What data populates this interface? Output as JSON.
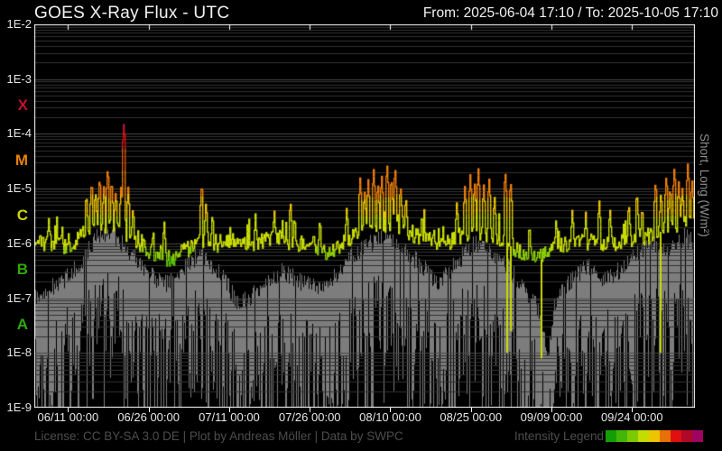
{
  "header": {
    "title": "GOES X-Ray Flux - UTC",
    "date_range": "From: 2025-06-04 17:10  /  To: 2025-10-05 17:10"
  },
  "axes": {
    "right_label": "Short, Long (W/m²)",
    "y_ticks": [
      {
        "label": "1E-2",
        "exp": -2
      },
      {
        "label": "1E-3",
        "exp": -3
      },
      {
        "label": "1E-4",
        "exp": -4
      },
      {
        "label": "1E-5",
        "exp": -5
      },
      {
        "label": "1E-6",
        "exp": -6
      },
      {
        "label": "1E-7",
        "exp": -7
      },
      {
        "label": "1E-8",
        "exp": -8
      },
      {
        "label": "1E-9",
        "exp": -9
      }
    ],
    "class_letters": [
      {
        "label": "X",
        "exp_mid": -3.5,
        "color": "#c41030"
      },
      {
        "label": "M",
        "exp_mid": -4.5,
        "color": "#e8820a"
      },
      {
        "label": "C",
        "exp_mid": -5.5,
        "color": "#cdd60a"
      },
      {
        "label": "B",
        "exp_mid": -6.5,
        "color": "#2fa90c"
      },
      {
        "label": "A",
        "exp_mid": -7.5,
        "color": "#2fa90c"
      }
    ],
    "x_ticks": [
      {
        "day": 6.285,
        "label": "06/11 00:00"
      },
      {
        "day": 21.285,
        "label": "06/26 00:00"
      },
      {
        "day": 36.285,
        "label": "07/11 00:00"
      },
      {
        "day": 51.285,
        "label": "07/26 00:00"
      },
      {
        "day": 66.285,
        "label": "08/10 00:00"
      },
      {
        "day": 81.285,
        "label": "08/25 00:00"
      },
      {
        "day": 96.285,
        "label": "09/09 00:00"
      },
      {
        "day": 111.285,
        "label": "09/24 00:00"
      }
    ]
  },
  "footer": {
    "license": "License: CC BY-SA 3.0 DE | Plot by Andreas Möller | Data by SWPC",
    "intensity_legend_label": "Intensity Legend"
  },
  "chart_data": {
    "type": "line",
    "title": "GOES X-Ray Flux - UTC",
    "x_start": "2025-06-04 17:10",
    "x_end": "2025-10-05 17:10",
    "days_total": 123,
    "ylog_range": [
      -9,
      -2
    ],
    "grid": "log-minor-gray",
    "legend_position": "bottom-right",
    "legend_colors": [
      "#149e06",
      "#45b508",
      "#7cc904",
      "#c4dc02",
      "#ecc400",
      "#e87008",
      "#e01010",
      "#b00828",
      "#a00460"
    ],
    "dropout_color": "#c9d900",
    "color_scale": [
      {
        "max": -6.55,
        "color": "#2aa30a"
      },
      {
        "max": -6.3,
        "color": "#55b907"
      },
      {
        "max": -6.1,
        "color": "#8ccc04"
      },
      {
        "max": -5.5,
        "color": "#c9dc02"
      },
      {
        "max": -5.15,
        "color": "#ecc400"
      },
      {
        "max": -4.6,
        "color": "#ee7e08"
      },
      {
        "max": -4.25,
        "color": "#e2560a"
      },
      {
        "max": -3.95,
        "color": "#dd1112"
      },
      {
        "max": 99,
        "color": "#b5123c"
      }
    ],
    "series": [
      {
        "name": "Long",
        "style": "intensity-colored",
        "anchors": [
          [
            0,
            -6.0
          ],
          [
            2,
            -6.05
          ],
          [
            4,
            -5.95
          ],
          [
            6,
            -6.1
          ],
          [
            8,
            -5.9
          ],
          [
            10,
            -5.78
          ],
          [
            13,
            -5.68
          ],
          [
            16,
            -5.75
          ],
          [
            19,
            -6.0
          ],
          [
            22,
            -6.2
          ],
          [
            25,
            -6.3
          ],
          [
            28,
            -6.15
          ],
          [
            31,
            -5.92
          ],
          [
            34,
            -6.02
          ],
          [
            37,
            -5.98
          ],
          [
            40,
            -6.02
          ],
          [
            44,
            -5.92
          ],
          [
            48,
            -6.0
          ],
          [
            52,
            -6.05
          ],
          [
            55,
            -6.18
          ],
          [
            58,
            -5.95
          ],
          [
            61,
            -5.78
          ],
          [
            64,
            -5.72
          ],
          [
            67,
            -5.68
          ],
          [
            70,
            -5.82
          ],
          [
            73,
            -5.95
          ],
          [
            76,
            -6.05
          ],
          [
            79,
            -5.92
          ],
          [
            82,
            -5.78
          ],
          [
            85,
            -5.85
          ],
          [
            88,
            -6.0
          ],
          [
            91,
            -6.25
          ],
          [
            94,
            -6.3
          ],
          [
            97,
            -6.1
          ],
          [
            100,
            -6.02
          ],
          [
            103,
            -5.98
          ],
          [
            106,
            -6.05
          ],
          [
            109,
            -6.0
          ],
          [
            112,
            -5.92
          ],
          [
            115,
            -5.85
          ],
          [
            118,
            -5.72
          ],
          [
            121,
            -5.62
          ],
          [
            123,
            -5.68
          ]
        ]
      },
      {
        "name": "Short",
        "style": "gray",
        "color": "#7d7d7d",
        "anchors": [
          [
            0,
            -7.2
          ],
          [
            3,
            -7.0
          ],
          [
            6,
            -6.8
          ],
          [
            9,
            -6.45
          ],
          [
            12,
            -6.0
          ],
          [
            14,
            -5.95
          ],
          [
            17,
            -6.25
          ],
          [
            20,
            -6.6
          ],
          [
            24,
            -6.95
          ],
          [
            28,
            -6.6
          ],
          [
            31,
            -6.35
          ],
          [
            35,
            -6.8
          ],
          [
            38,
            -7.3
          ],
          [
            42,
            -7.0
          ],
          [
            46,
            -6.7
          ],
          [
            50,
            -6.9
          ],
          [
            54,
            -7.0
          ],
          [
            58,
            -6.5
          ],
          [
            62,
            -6.2
          ],
          [
            65,
            -6.05
          ],
          [
            68,
            -6.25
          ],
          [
            72,
            -6.55
          ],
          [
            75,
            -6.9
          ],
          [
            78,
            -6.6
          ],
          [
            82,
            -6.15
          ],
          [
            85,
            -6.35
          ],
          [
            88,
            -6.55
          ],
          [
            91,
            -7.0
          ],
          [
            94,
            -7.4
          ],
          [
            95.5,
            -8.3
          ],
          [
            97,
            -7.2
          ],
          [
            100,
            -6.85
          ],
          [
            103,
            -6.55
          ],
          [
            106,
            -6.85
          ],
          [
            109,
            -6.65
          ],
          [
            112,
            -6.35
          ],
          [
            115,
            -6.15
          ],
          [
            118,
            -6.25
          ],
          [
            121,
            -6.05
          ],
          [
            123,
            -6.2
          ]
        ]
      }
    ],
    "flares": [
      [
        2.5,
        -5.5
      ],
      [
        5,
        -5.62
      ],
      [
        9.5,
        -5.05
      ],
      [
        10.5,
        -4.82
      ],
      [
        11.2,
        -5.0
      ],
      [
        12,
        -4.75
      ],
      [
        12.8,
        -4.9
      ],
      [
        13.5,
        -4.58
      ],
      [
        14.2,
        -4.8
      ],
      [
        15,
        -5.0
      ],
      [
        16,
        -4.9
      ],
      [
        16.5,
        -3.76
      ],
      [
        17.3,
        -4.95
      ],
      [
        18.2,
        -5.3
      ],
      [
        24,
        -5.55
      ],
      [
        31,
        -4.85
      ],
      [
        31.8,
        -5.2
      ],
      [
        33,
        -5.4
      ],
      [
        41,
        -5.45
      ],
      [
        44.5,
        -5.35
      ],
      [
        47.5,
        -5.18
      ],
      [
        48.3,
        -5.45
      ],
      [
        53,
        -5.5
      ],
      [
        58,
        -5.3
      ],
      [
        60.5,
        -4.78
      ],
      [
        61.3,
        -5.0
      ],
      [
        62,
        -4.82
      ],
      [
        63,
        -4.62
      ],
      [
        63.8,
        -4.85
      ],
      [
        64.5,
        -4.72
      ],
      [
        65.5,
        -4.52
      ],
      [
        66.3,
        -4.75
      ],
      [
        67,
        -4.58
      ],
      [
        68,
        -4.9
      ],
      [
        69,
        -5.1
      ],
      [
        72,
        -5.4
      ],
      [
        78.5,
        -5.2
      ],
      [
        80,
        -4.92
      ],
      [
        81,
        -4.72
      ],
      [
        81.8,
        -4.85
      ],
      [
        82.5,
        -4.62
      ],
      [
        83.5,
        -4.9
      ],
      [
        84.5,
        -4.78
      ],
      [
        85.5,
        -5.1
      ],
      [
        87.5,
        -4.65
      ],
      [
        88.5,
        -4.82
      ],
      [
        92,
        -5.6
      ],
      [
        97,
        -5.5
      ],
      [
        100,
        -5.35
      ],
      [
        102.5,
        -5.42
      ],
      [
        105,
        -5.18
      ],
      [
        107,
        -5.32
      ],
      [
        110.5,
        -5.22
      ],
      [
        112,
        -5.02
      ],
      [
        113,
        -5.28
      ],
      [
        115.5,
        -4.82
      ],
      [
        116.5,
        -5.02
      ],
      [
        117.5,
        -4.72
      ],
      [
        118.2,
        -4.92
      ],
      [
        119,
        -4.58
      ],
      [
        119.8,
        -4.85
      ],
      [
        120.5,
        -4.95
      ],
      [
        121.5,
        -4.52
      ],
      [
        122.3,
        -4.8
      ]
    ],
    "dropouts": [
      [
        87.8,
        -8.0
      ],
      [
        88.6,
        -7.6
      ],
      [
        94.2,
        -8.1
      ],
      [
        116.5,
        -8.0
      ]
    ]
  }
}
